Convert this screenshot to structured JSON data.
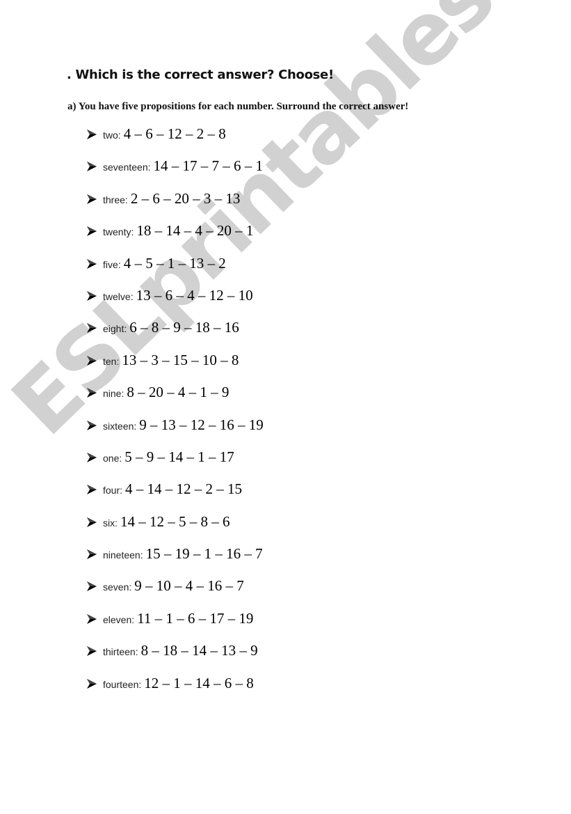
{
  "document": {
    "title": ". Which is the correct answer? Choose!",
    "instruction": "a) You have five propositions for each number. Surround the correct answer!",
    "bullet_icon": "arrow-bullet-icon",
    "items": [
      {
        "word": "two",
        "sep": " :",
        "options": "4 – 6 – 12 – 2 – 8"
      },
      {
        "word": "seventeen",
        "sep": " :",
        "options": "14 – 17 – 7 – 6 – 1"
      },
      {
        "word": "three",
        "sep": " :",
        "options": "2 – 6 – 20 – 3 – 13"
      },
      {
        "word": "twenty",
        "sep": " :",
        "options": "18 – 14 – 4 – 20 – 1"
      },
      {
        "word": "five",
        "sep": " :",
        "options": "4 – 5 – 1 – 13 – 2"
      },
      {
        "word": "twelve",
        "sep": " :",
        "options": "13 – 6 – 4 – 12 – 10"
      },
      {
        "word": "eight",
        "sep": " :",
        "options": "6 – 8 – 9 – 18 – 16"
      },
      {
        "word": "ten",
        "sep": " :",
        "options": "13 – 3 – 15 – 10 – 8"
      },
      {
        "word": "nine",
        "sep": " :",
        "options": "8 – 20 – 4 – 1 – 9"
      },
      {
        "word": "sixteen",
        "sep": ":",
        "options": "9 – 13 – 12 – 16 – 19"
      },
      {
        "word": "one",
        "sep": " :",
        "options": "5 – 9 – 14 – 1 – 17"
      },
      {
        "word": "four",
        "sep": " :",
        "options": "4 – 14 – 12 – 2 – 15"
      },
      {
        "word": "six",
        "sep": " :",
        "options": "14 – 12 – 5 – 8 – 6"
      },
      {
        "word": "nineteen",
        "sep": " :",
        "options": "15 – 19 – 1 – 16 – 7"
      },
      {
        "word": "seven",
        "sep": ":",
        "options": "9 – 10 – 4 – 16 – 7"
      },
      {
        "word": "eleven",
        "sep": " :",
        "options": "11 – 1 – 6 – 17 – 19"
      },
      {
        "word": "thirteen",
        "sep": " :",
        "options": "8 – 18 – 14 – 13 – 9"
      },
      {
        "word": "fourteen",
        "sep": " :",
        "options": "12 – 1 – 14 – 6 – 8"
      }
    ]
  },
  "watermark": {
    "text": "ESLprintables.com",
    "color": "#c9c9c9"
  }
}
